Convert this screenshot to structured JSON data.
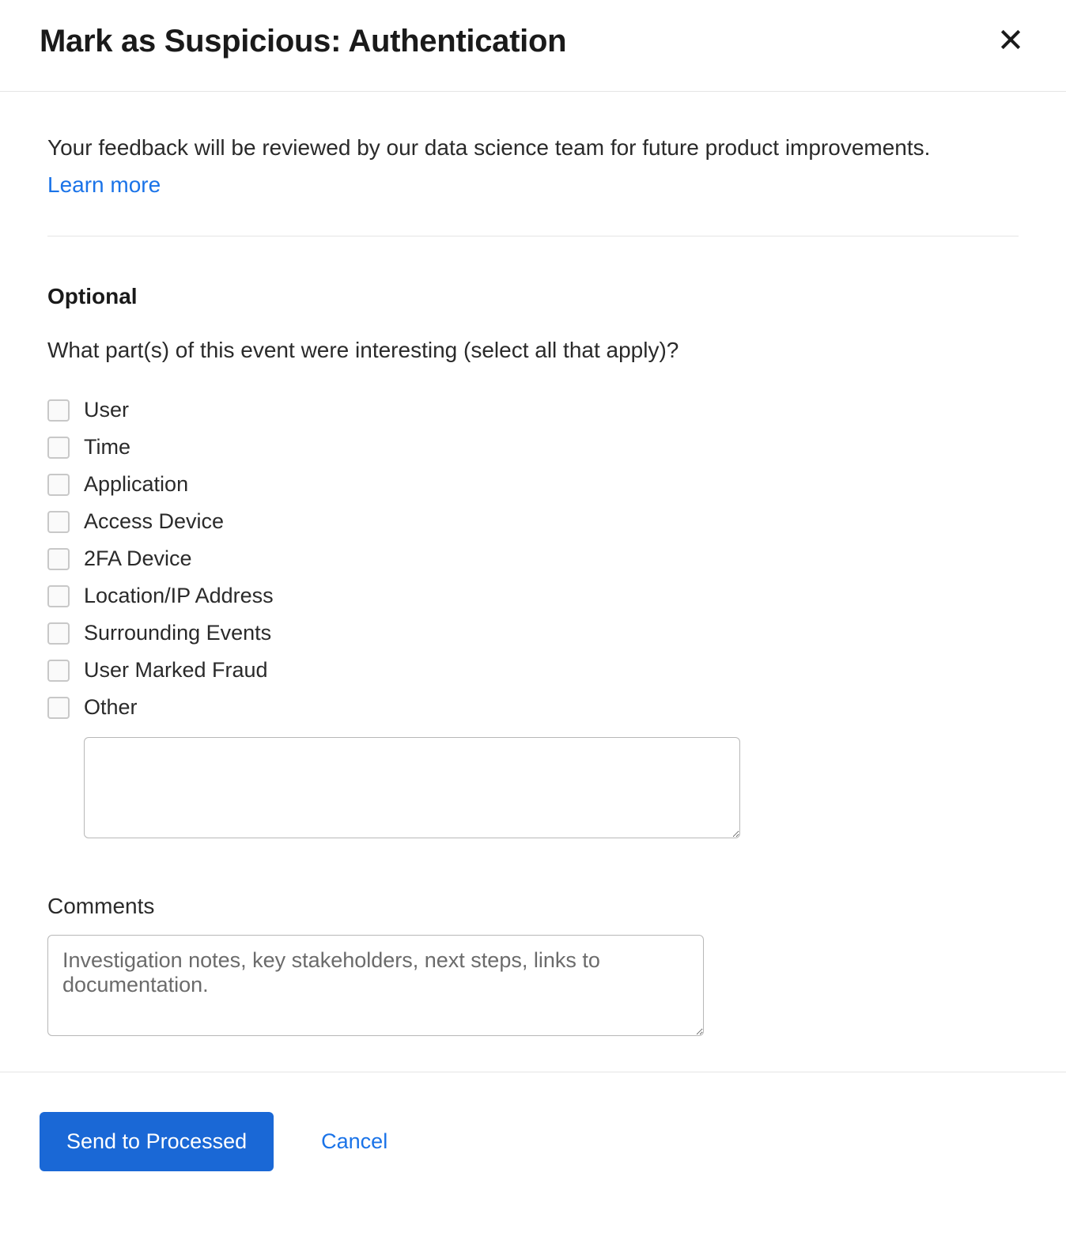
{
  "modal": {
    "title": "Mark as Suspicious: Authentication",
    "intro": "Your feedback will be reviewed by our data science team for future product improvements.",
    "learn_more": "Learn more",
    "optional_heading": "Optional",
    "question": "What part(s) of this event were interesting (select all that apply)?",
    "checkboxes": [
      {
        "label": "User"
      },
      {
        "label": "Time"
      },
      {
        "label": "Application"
      },
      {
        "label": "Access Device"
      },
      {
        "label": "2FA Device"
      },
      {
        "label": "Location/IP Address"
      },
      {
        "label": "Surrounding Events"
      },
      {
        "label": "User Marked Fraud"
      },
      {
        "label": "Other"
      }
    ],
    "other_value": "",
    "comments_label": "Comments",
    "comments_placeholder": "Investigation notes, key stakeholders, next steps, links to documentation.",
    "comments_value": "",
    "footer": {
      "primary": "Send to Processed",
      "cancel": "Cancel"
    }
  }
}
